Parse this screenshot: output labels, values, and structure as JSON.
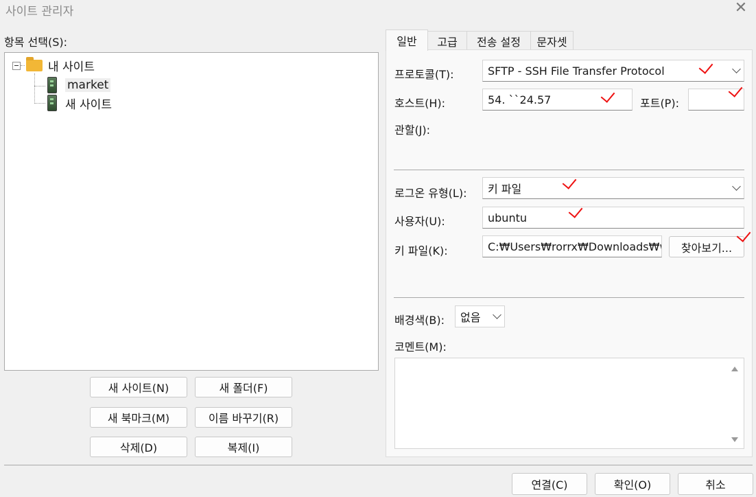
{
  "window": {
    "title": "사이트 관리자"
  },
  "left": {
    "select_label": "항목 선택(S):",
    "tree": {
      "root": "내 사이트",
      "children": [
        "market",
        "새 사이트"
      ]
    },
    "buttons": {
      "new_site": "새 사이트(N)",
      "new_folder": "새 폴더(F)",
      "new_bookmark": "새 북마크(M)",
      "rename": "이름 바꾸기(R)",
      "delete": "삭제(D)",
      "duplicate": "복제(I)"
    }
  },
  "tabs": [
    "일반",
    "고급",
    "전송 설정",
    "문자셋"
  ],
  "general": {
    "protocol_label": "프로토콜(T):",
    "protocol_value": "SFTP - SSH File Transfer Protocol",
    "host_label": "호스트(H):",
    "host_value": "54.    ``24.57",
    "port_label": "포트(P):",
    "port_value": "",
    "encryption_label": "관할(J):",
    "logon_type_label": "로그온 유형(L):",
    "logon_type_value": "키 파일",
    "user_label": "사용자(U):",
    "user_value": "ubuntu",
    "keyfile_label": "키 파일(K):",
    "keyfile_value": "C:₩Users₩rorrx₩Downloads₩w",
    "browse_label": "찾아보기...",
    "bgcolor_label": "배경색(B):",
    "bgcolor_value": "없음",
    "comment_label": "코멘트(M):"
  },
  "footer": {
    "connect": "연결(C)",
    "ok": "확인(O)",
    "cancel": "취소"
  },
  "colors": {
    "annotation": "#e11111",
    "folder": "#f2b736"
  }
}
